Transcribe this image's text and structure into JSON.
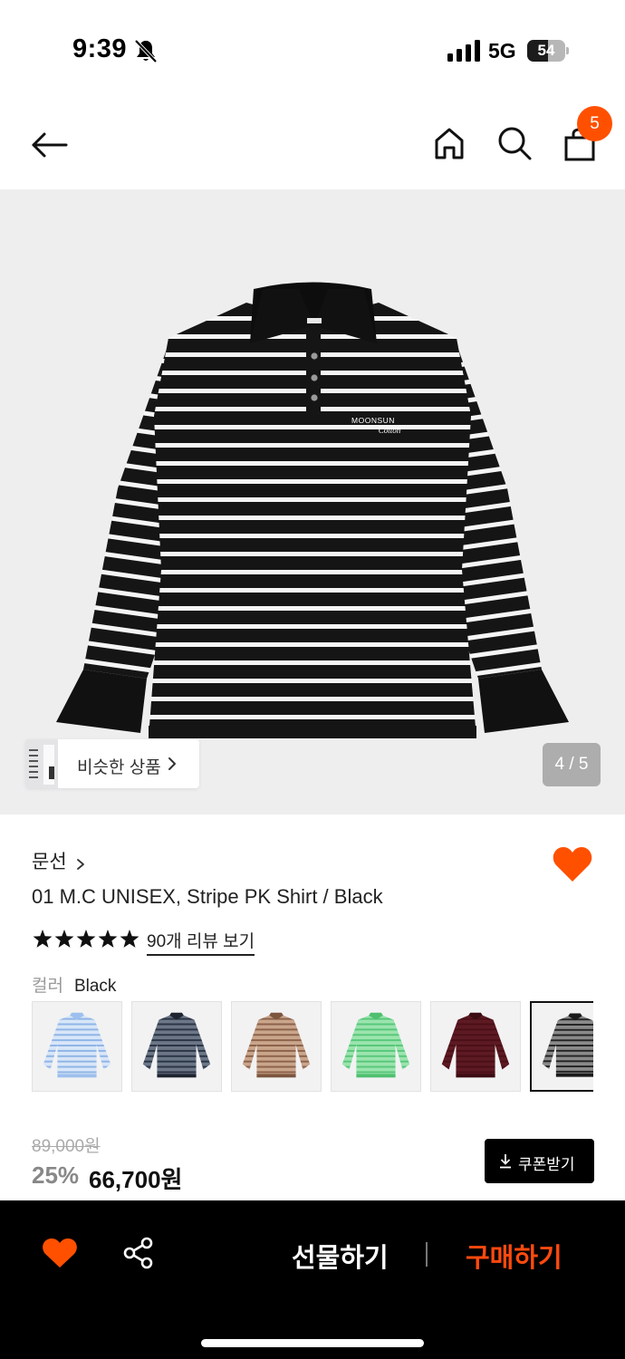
{
  "status_bar": {
    "time": "9:39",
    "network": "5G",
    "battery": "54",
    "battery_level": 0.54
  },
  "nav": {
    "back_icon": "arrow-left-icon",
    "home_icon": "home-icon",
    "search_icon": "search-icon",
    "cart_icon": "shopping-bag-icon",
    "cart_count": "5"
  },
  "gallery": {
    "similar_label": "비슷한 상품",
    "counter": "4 / 5",
    "logo_line1": "MOONSUN",
    "logo_line2": "Cotton"
  },
  "product": {
    "brand": "문선",
    "title": "01 M.C UNISEX, Stripe PK Shirt / Black",
    "rating_stars": 5,
    "review_link": "90개 리뷰 보기",
    "color_label": "컬러",
    "color_value": "Black",
    "swatches": [
      {
        "stripe": "#8fb4e6",
        "base": "#d8e6f8",
        "collar": "#9ec0ee"
      },
      {
        "stripe": "#2b3443",
        "base": "#6b7687",
        "collar": "#1f2530"
      },
      {
        "stripe": "#8c6249",
        "base": "#c9a58c",
        "collar": "#7d5640"
      },
      {
        "stripe": "#58c77a",
        "base": "#9be4ae",
        "collar": "#4fbf70"
      },
      {
        "stripe": "#4a0f17",
        "base": "#5d1a22",
        "collar": "#3c0c13"
      },
      {
        "stripe": "#222222",
        "base": "#8a8a8a",
        "collar": "#1a1a1a"
      }
    ],
    "selected_swatch": 5,
    "original_price": "89,000원",
    "discount": "25%",
    "sale_price": "66,700원",
    "coupon_label": "쿠폰받기"
  },
  "bottom_bar": {
    "gift_label": "선물하기",
    "buy_label": "구매하기",
    "heart_icon": "heart-icon",
    "share_icon": "share-icon"
  },
  "colors": {
    "accent": "#ff5000",
    "buy": "#ff4a0e",
    "bottom_bar": "#000000"
  }
}
